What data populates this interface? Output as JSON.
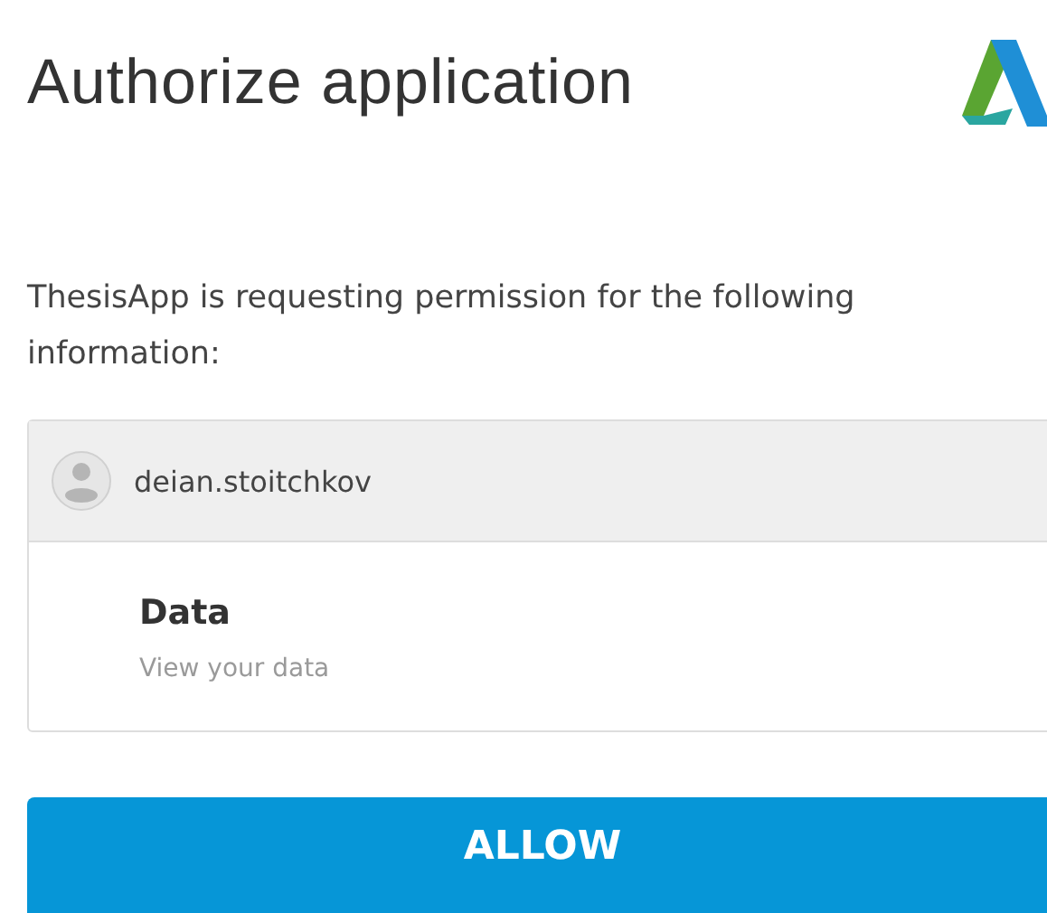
{
  "title": "Authorize application",
  "message": "ThesisApp is requesting permission for the following information:",
  "account": {
    "username": "deian.stoitchkov"
  },
  "permissions": [
    {
      "name": "Data",
      "description": "View your data"
    }
  ],
  "buttons": [
    {
      "label": "ALLOW"
    }
  ]
}
